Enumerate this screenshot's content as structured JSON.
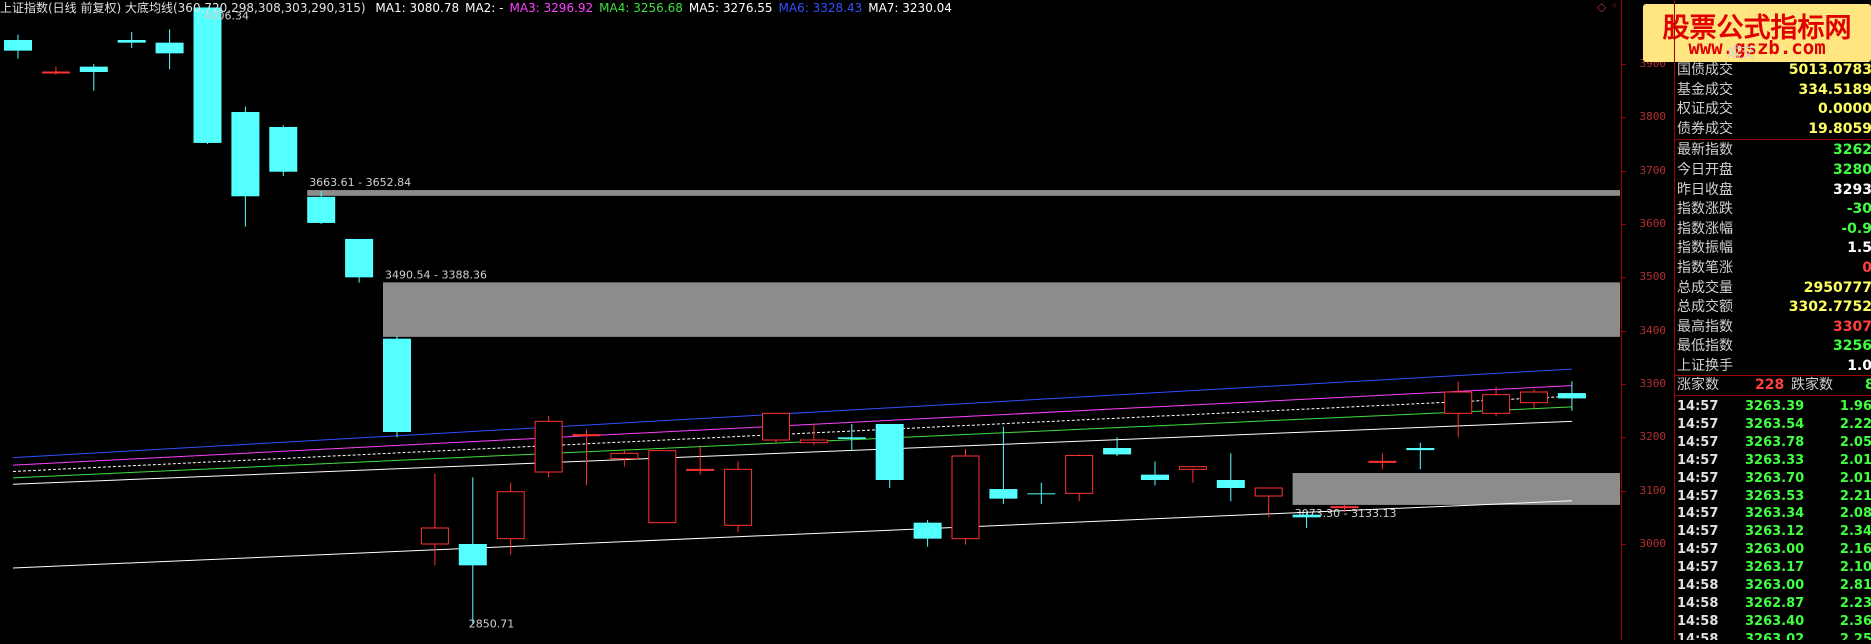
{
  "header": {
    "title": "上证指数(日线 前复权) 大底均线(360,720,298,308,303,290,315)",
    "ma": [
      {
        "label": "MA1: 3080.78",
        "color": "#ffffff"
      },
      {
        "label": "MA2: -",
        "color": "#ffffff"
      },
      {
        "label": "MA3: 3296.92",
        "color": "#ff40ff"
      },
      {
        "label": "MA4: 3256.68",
        "color": "#40e040"
      },
      {
        "label": "MA5: 3276.55",
        "color": "#ffffff"
      },
      {
        "label": "MA6: 3328.43",
        "color": "#3050ff"
      },
      {
        "label": "MA7: 3230.04",
        "color": "#ffffff"
      }
    ],
    "corner_icon": "diamond-icon"
  },
  "yaxis": {
    "ticks": [
      "3900",
      "3800",
      "3700",
      "3600",
      "3500",
      "3400",
      "3300",
      "3200",
      "3100",
      "3000"
    ]
  },
  "chart_data": {
    "type": "candlestick",
    "ylim": [
      2820,
      4020
    ],
    "up_color": "#ff3232",
    "down_color": "#54ffff",
    "candles": [
      [
        3945,
        3955,
        3910,
        3925
      ],
      [
        3885,
        3895,
        3880,
        3885
      ],
      [
        3895,
        3900,
        3850,
        3885
      ],
      [
        3945,
        3960,
        3930,
        3940
      ],
      [
        3940,
        3965,
        3890,
        3920
      ],
      [
        4006,
        4006,
        3750,
        3752
      ],
      [
        3810,
        3820,
        3595,
        3652
      ],
      [
        3782,
        3785,
        3690,
        3698
      ],
      [
        3651,
        3662,
        3600,
        3602
      ],
      [
        3572,
        3572,
        3490,
        3500
      ],
      [
        3385,
        3390,
        3200,
        3210
      ],
      [
        3000,
        3132,
        2960,
        3030
      ],
      [
        3000,
        3125,
        2850,
        2960
      ],
      [
        3010,
        3115,
        2980,
        3098
      ],
      [
        3135,
        3240,
        3125,
        3230
      ],
      [
        3205,
        3215,
        3110,
        3205
      ],
      [
        3160,
        3175,
        3145,
        3170
      ],
      [
        3040,
        3175,
        3040,
        3175
      ],
      [
        3138,
        3185,
        3130,
        3140
      ],
      [
        3035,
        3155,
        3022,
        3140
      ],
      [
        3195,
        3245,
        3190,
        3245
      ],
      [
        3190,
        3225,
        3185,
        3195
      ],
      [
        3200,
        3225,
        3175,
        3197
      ],
      [
        3225,
        3225,
        3105,
        3120
      ],
      [
        3040,
        3045,
        2995,
        3010
      ],
      [
        3010,
        3178,
        2999,
        3165
      ],
      [
        3103,
        3220,
        3075,
        3085
      ],
      [
        3095,
        3115,
        3075,
        3094
      ],
      [
        3095,
        3168,
        3080,
        3166
      ],
      [
        3180,
        3200,
        3165,
        3168
      ],
      [
        3130,
        3155,
        3110,
        3120
      ],
      [
        3140,
        3146,
        3115,
        3145
      ],
      [
        3120,
        3170,
        3080,
        3105
      ],
      [
        3090,
        3090,
        3050,
        3105
      ],
      [
        3055,
        3060,
        3030,
        3050
      ],
      [
        3070,
        3073,
        3060,
        3070
      ],
      [
        3155,
        3170,
        3140,
        3155
      ],
      [
        3180,
        3190,
        3140,
        3176
      ],
      [
        3245,
        3305,
        3200,
        3285
      ],
      [
        3245,
        3295,
        3240,
        3280
      ],
      [
        3265,
        3290,
        3255,
        3285
      ],
      [
        3283,
        3305,
        3250,
        3273
      ]
    ],
    "zones": [
      {
        "low": 3652.84,
        "high": 3663.61,
        "label": "3663.61 - 3652.84",
        "start_index": 8
      },
      {
        "low": 3388.36,
        "high": 3490.54,
        "label": "3490.54 - 3388.36",
        "start_index": 10
      },
      {
        "low": 3073.3,
        "high": 3133.13,
        "label": "3073.30 - 3133.13",
        "start_index": 34
      }
    ],
    "peak_label": "4006.34",
    "trough_label": "2850.71",
    "ma_lines": [
      {
        "name": "MA6",
        "color": "#3050ff",
        "start": 3162,
        "end": 3328,
        "dash": false
      },
      {
        "name": "MA3",
        "color": "#ff40ff",
        "start": 3148,
        "end": 3297,
        "dash": false
      },
      {
        "name": "MA5",
        "color": "#ffffff",
        "start": 3136,
        "end": 3277,
        "dash": true
      },
      {
        "name": "MA4",
        "color": "#40e040",
        "start": 3124,
        "end": 3257,
        "dash": false
      },
      {
        "name": "MA7",
        "color": "#ffffff",
        "start": 3112,
        "end": 3230,
        "dash": false
      },
      {
        "name": "MA1",
        "color": "#ffffff",
        "start": 2955,
        "end": 3081,
        "dash": false
      }
    ]
  },
  "watermark": {
    "line1": "股票公式指标网",
    "line2": "www.gszb.com"
  },
  "panel": {
    "partial_label": "成交",
    "info_rows": [
      {
        "label": "国债成交",
        "value": "5013.0783",
        "color": "#ffff60"
      },
      {
        "label": "基金成交",
        "value": "334.5189",
        "color": "#ffff60"
      },
      {
        "label": "权证成交",
        "value": "0.0000",
        "color": "#ffff60"
      },
      {
        "label": "债券成交",
        "value": "19.8059",
        "color": "#ffff60"
      },
      {
        "label": "最新指数",
        "value": "3262",
        "color": "#40ff40"
      },
      {
        "label": "今日开盘",
        "value": "3280",
        "color": "#40ff40"
      },
      {
        "label": "昨日收盘",
        "value": "3293",
        "color": "#ffffff"
      },
      {
        "label": "指数涨跌",
        "value": "-30",
        "color": "#40ff40"
      },
      {
        "label": "指数涨幅",
        "value": "-0.9",
        "color": "#40ff40"
      },
      {
        "label": "指数振幅",
        "value": "1.5",
        "color": "#ffffff"
      },
      {
        "label": "指数笔涨",
        "value": "0",
        "color": "#ff4040"
      },
      {
        "label": "总成交量",
        "value": "2950777",
        "color": "#ffff60"
      },
      {
        "label": "总成交额",
        "value": "3302.7752",
        "color": "#ffff60"
      },
      {
        "label": "最高指数",
        "value": "3307",
        "color": "#ff4040"
      },
      {
        "label": "最低指数",
        "value": "3256",
        "color": "#40ff40"
      },
      {
        "label": "上证换手",
        "value": "1.0",
        "color": "#ffffff"
      }
    ],
    "rise_label": "涨家数",
    "rise_value": "228",
    "fall_label": "跌家数",
    "fall_value": "8",
    "ticks": [
      {
        "time": "14:57",
        "price": "3263.39",
        "vol": "1.96"
      },
      {
        "time": "14:57",
        "price": "3263.54",
        "vol": "2.22"
      },
      {
        "time": "14:57",
        "price": "3263.78",
        "vol": "2.05"
      },
      {
        "time": "14:57",
        "price": "3263.33",
        "vol": "2.01"
      },
      {
        "time": "14:57",
        "price": "3263.70",
        "vol": "2.01"
      },
      {
        "time": "14:57",
        "price": "3263.53",
        "vol": "2.21"
      },
      {
        "time": "14:57",
        "price": "3263.34",
        "vol": "2.08"
      },
      {
        "time": "14:57",
        "price": "3263.12",
        "vol": "2.34"
      },
      {
        "time": "14:57",
        "price": "3263.00",
        "vol": "2.16"
      },
      {
        "time": "14:57",
        "price": "3263.17",
        "vol": "2.10"
      },
      {
        "time": "14:58",
        "price": "3263.00",
        "vol": "2.81"
      },
      {
        "time": "14:58",
        "price": "3262.87",
        "vol": "2.23"
      },
      {
        "time": "14:58",
        "price": "3263.40",
        "vol": "2.36"
      },
      {
        "time": "14:58",
        "price": "3263.02",
        "vol": "2.25"
      }
    ]
  }
}
